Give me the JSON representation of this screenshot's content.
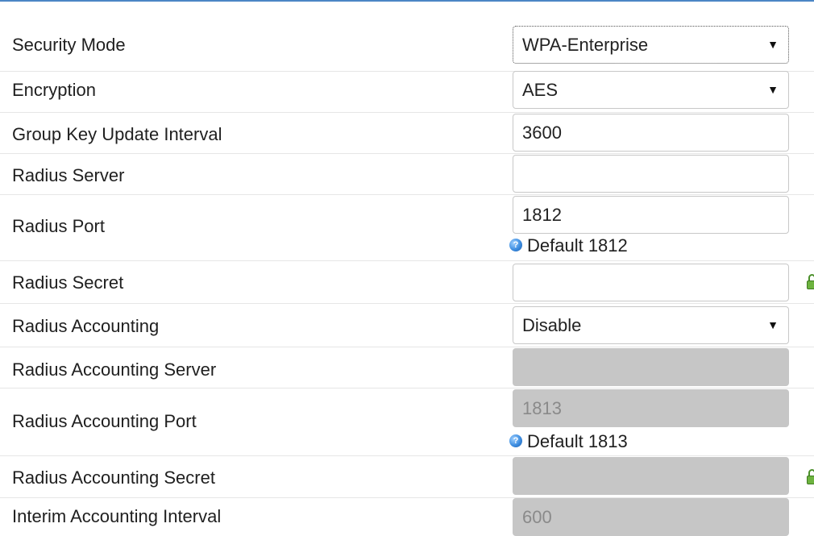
{
  "form": {
    "security_mode": {
      "label": "Security Mode",
      "value": "WPA-Enterprise"
    },
    "encryption": {
      "label": "Encryption",
      "value": "AES"
    },
    "group_key_update_interval": {
      "label": "Group Key Update Interval",
      "value": "3600"
    },
    "radius_server": {
      "label": "Radius Server",
      "value": ""
    },
    "radius_port": {
      "label": "Radius Port",
      "value": "1812",
      "hint": "Default 1812"
    },
    "radius_secret": {
      "label": "Radius Secret",
      "value": ""
    },
    "radius_accounting": {
      "label": "Radius Accounting",
      "value": "Disable"
    },
    "radius_accounting_server": {
      "label": "Radius Accounting Server",
      "value": ""
    },
    "radius_accounting_port": {
      "label": "Radius Accounting Port",
      "value": "1813",
      "hint": "Default 1813"
    },
    "radius_accounting_secret": {
      "label": "Radius Accounting Secret",
      "value": ""
    },
    "interim_accounting_interval": {
      "label": "Interim Accounting Interval",
      "value": "600"
    }
  },
  "icons": {
    "select_arrow": "▼",
    "help": "?"
  },
  "colors": {
    "accent_line": "#4b86c5",
    "disabled_field": "#c6c6c6",
    "lock_green": "#6db33f"
  }
}
